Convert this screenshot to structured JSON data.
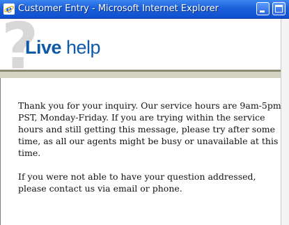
{
  "window": {
    "title": "Customer Entry - Microsoft Internet Explorer",
    "icon": "ie-icon",
    "controls": [
      "minimize",
      "maximize"
    ]
  },
  "header": {
    "logo_primary": "Live",
    "logo_secondary": "help",
    "background_glyph": "?",
    "brand_color": "#0f5aa8"
  },
  "content": {
    "paragraph_1": "Thank you for your inquiry. Our service hours are 9am-5pm PST, Monday-Friday. If you are trying within the service hours and still getting this message, please try after some time, as all our agents might be busy or unavailable at this time.",
    "paragraph_2": "If you were not able to have your question addressed, please contact us via email or phone."
  },
  "colors": {
    "titlebar": "#1c5fd9",
    "rule_dark": "#8a8a72",
    "rule_light": "#d3d3c3"
  }
}
